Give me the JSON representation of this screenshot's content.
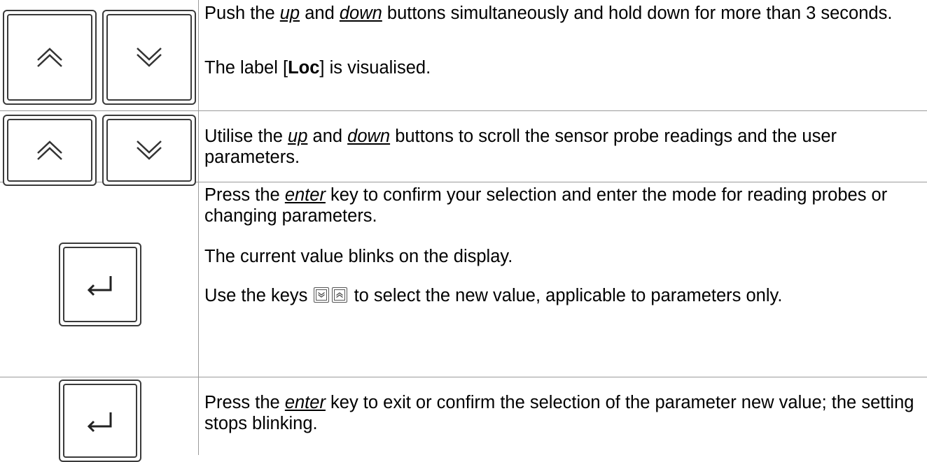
{
  "rows": [
    {
      "icons": [
        "up-arrow-key",
        "down-arrow-key"
      ],
      "paragraphs": [
        {
          "pre": "Push the ",
          "kw1": "up",
          "mid": " and ",
          "kw2": "down",
          "post": " buttons simultaneously and hold down for more than 3 seconds."
        },
        {
          "pre": "The label [",
          "bold": "Loc",
          "post": "] is visualised."
        }
      ]
    },
    {
      "icons": [
        "up-arrow-key",
        "down-arrow-key"
      ],
      "paragraphs": [
        {
          "pre": "Utilise the ",
          "kw1": "up",
          "mid": " and ",
          "kw2": "down",
          "post": " buttons to scroll the sensor probe readings and the user parameters."
        }
      ]
    },
    {
      "icons": [
        "enter-key"
      ],
      "paragraphs": [
        {
          "pre": "Press the ",
          "kw": "enter",
          "post": " key to confirm your selection and enter the mode for reading probes or changing parameters."
        },
        {
          "text": "The current value blinks on the display."
        },
        {
          "pre": "Use the keys ",
          "post": " to select the new value, applicable to parameters only."
        }
      ],
      "inline_icons": [
        "down-arrow-key",
        "up-arrow-key"
      ]
    },
    {
      "icons": [
        "enter-key"
      ],
      "paragraphs": [
        {
          "pre": "Press the ",
          "kw": "enter",
          "post": " key to exit or confirm the selection of the parameter new value; the setting stops blinking."
        }
      ]
    }
  ]
}
